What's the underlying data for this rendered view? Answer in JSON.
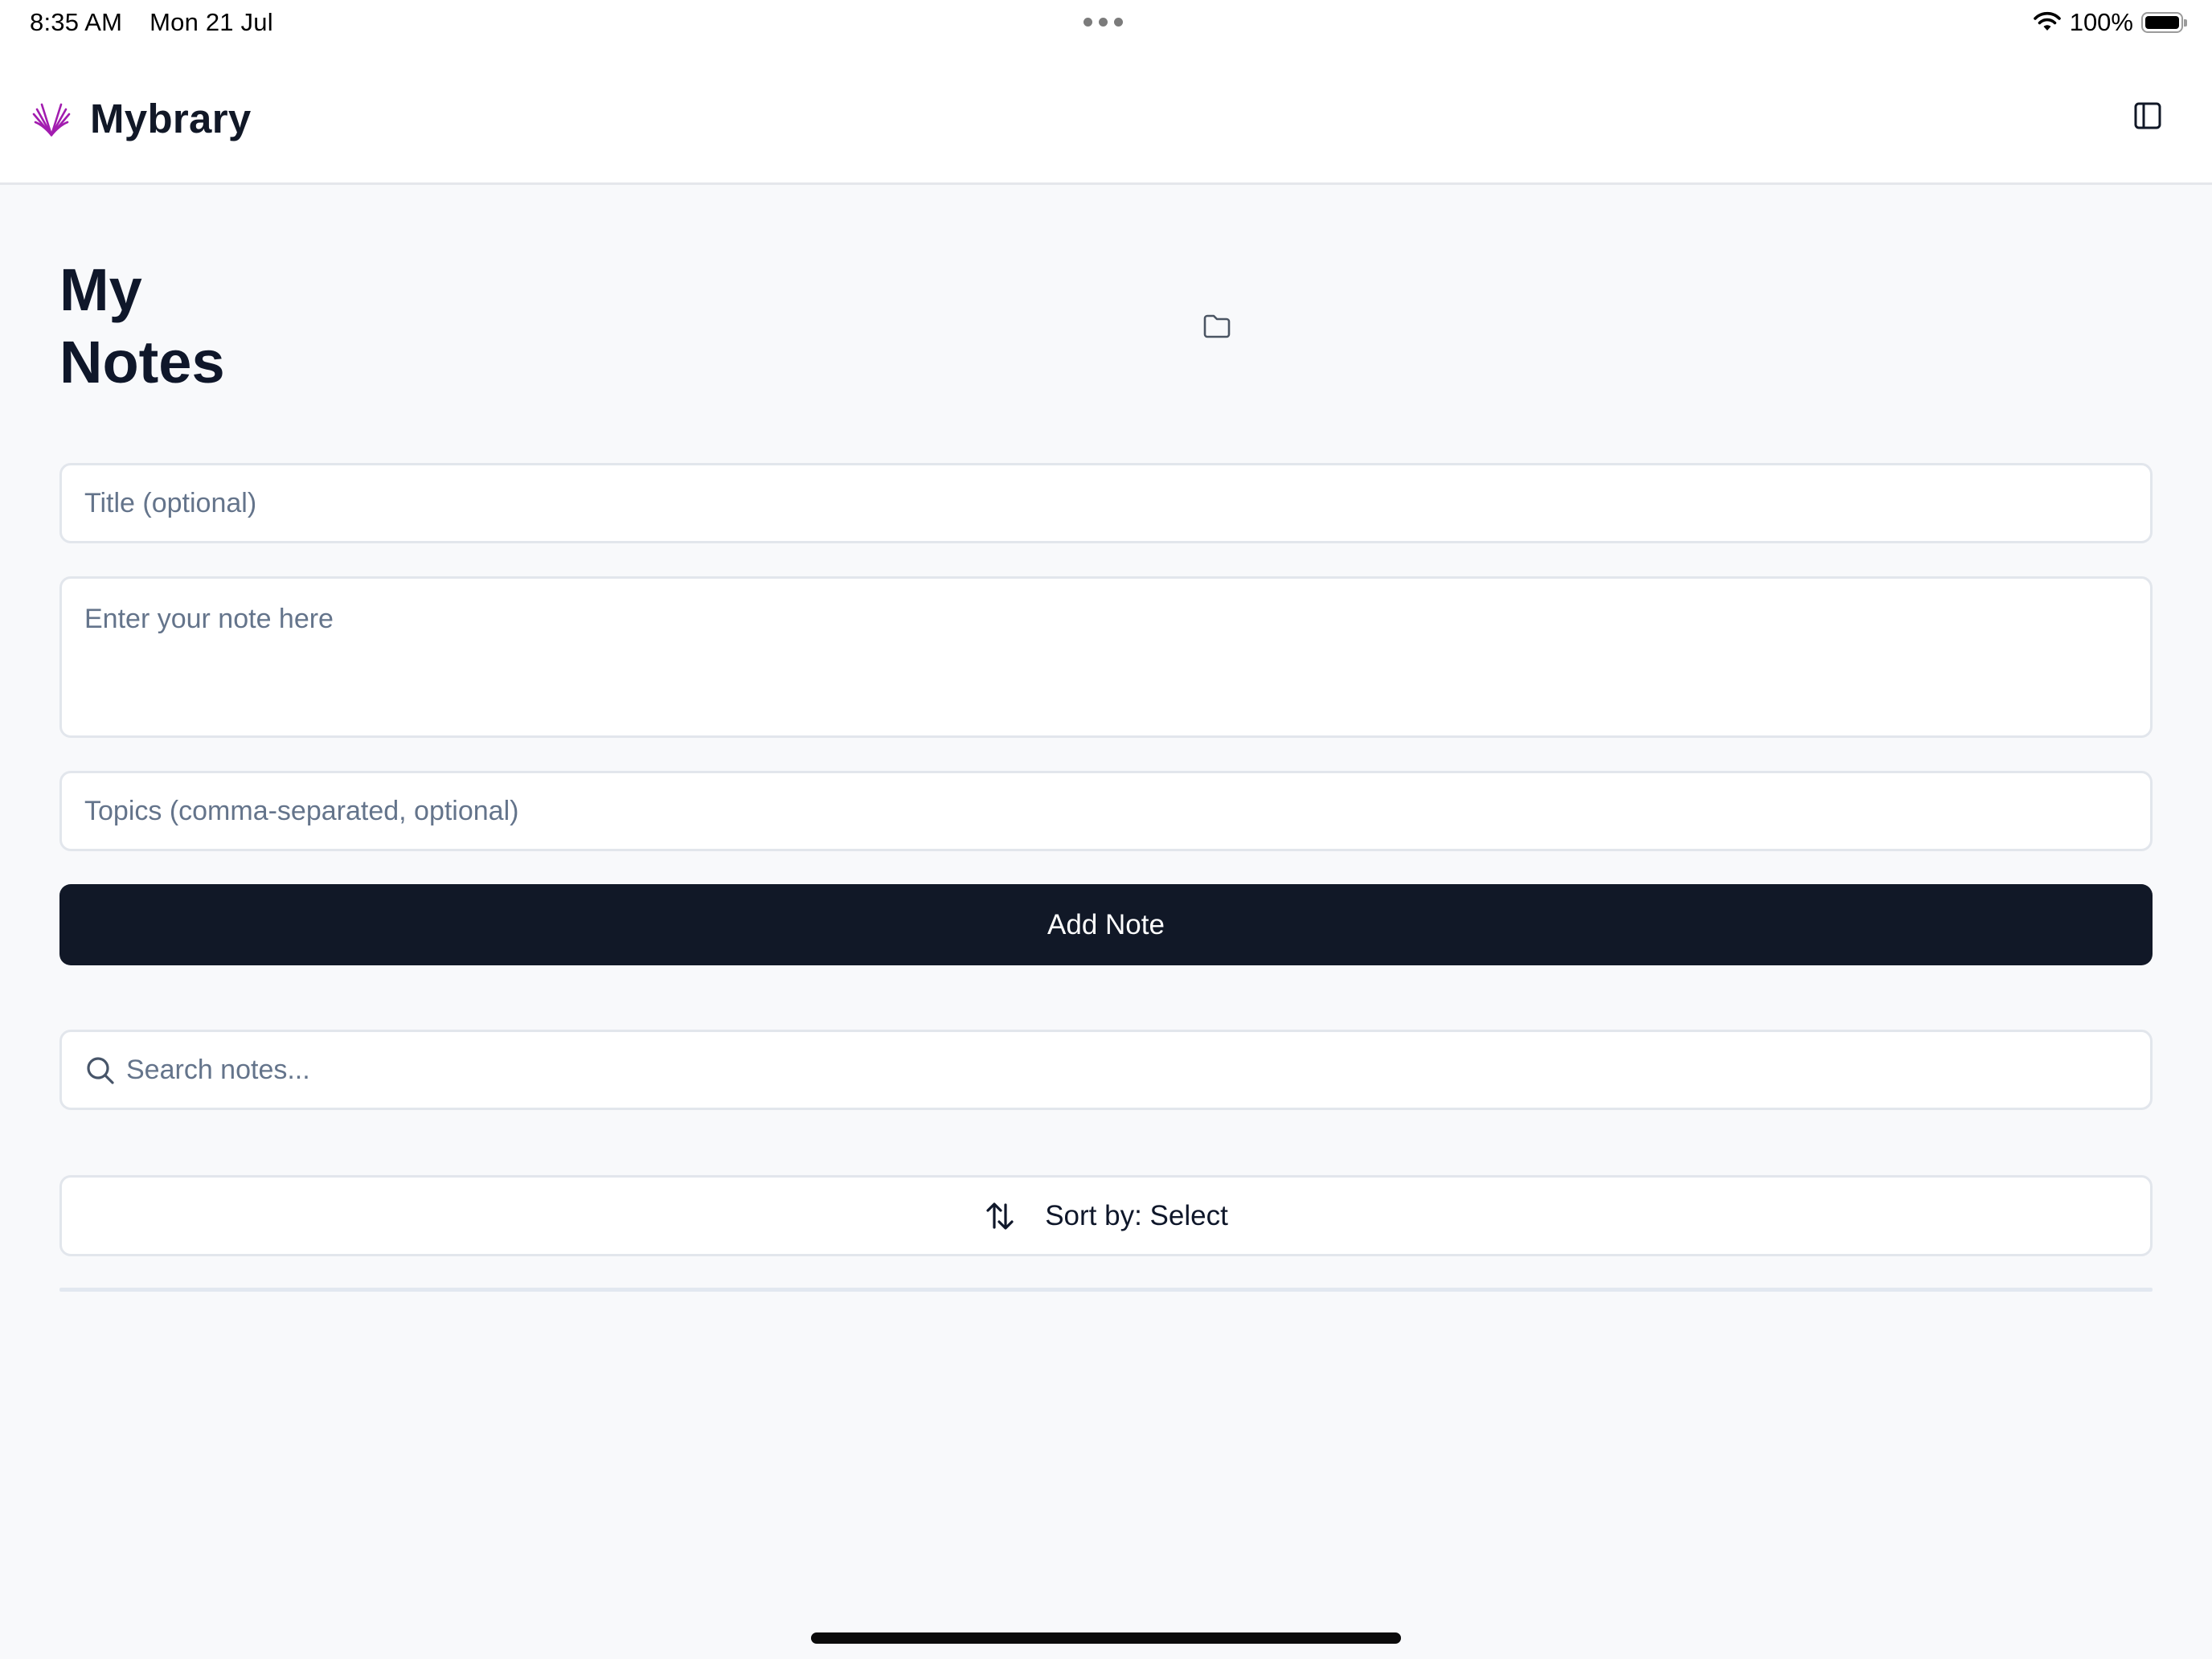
{
  "status_bar": {
    "time": "8:35 AM",
    "date": "Mon 21 Jul",
    "battery_percent": "100%",
    "icons": [
      "wifi-icon",
      "battery-icon",
      "multitasking-dots-icon"
    ]
  },
  "header": {
    "app_name": "Mybrary",
    "logo_icon": "book-wings-logo",
    "logo_color": "#a21caf",
    "toggle_icon": "sidebar-toggle-icon"
  },
  "main": {
    "title": "My Notes",
    "folder_icon": "folder-icon",
    "form": {
      "title_placeholder": "Title (optional)",
      "title_value": "",
      "note_placeholder": "Enter your note here",
      "note_value": "",
      "topics_placeholder": "Topics (comma-separated, optional)",
      "topics_value": "",
      "add_label": "Add Note",
      "add_color": "#111827"
    },
    "search": {
      "placeholder": "Search notes...",
      "value": "",
      "icon": "search-icon"
    },
    "sort": {
      "label": "Sort by: Select",
      "icon": "sort-arrows-icon"
    }
  }
}
